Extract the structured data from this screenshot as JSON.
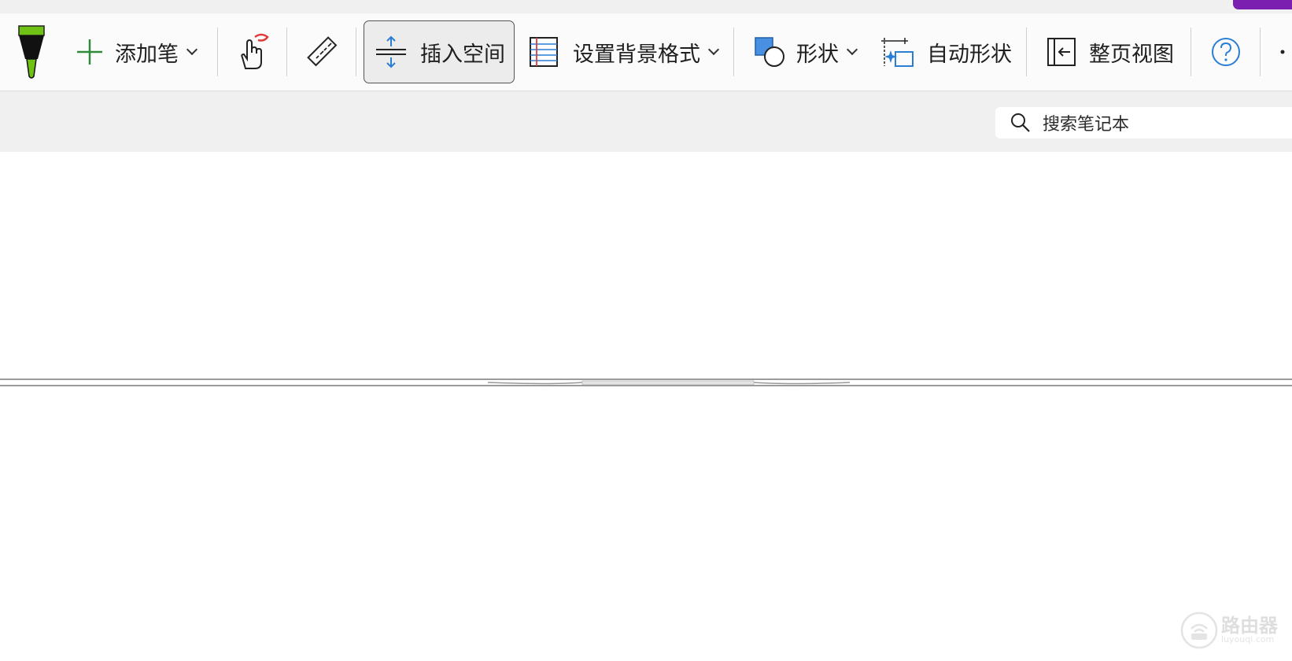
{
  "app": {
    "accent_color": "#7a1fb0"
  },
  "ribbon": {
    "pen_tool": {
      "icon": "pen-icon",
      "color": "#6fc114"
    },
    "add_pen": {
      "label": "添加笔",
      "icon": "plus-icon"
    },
    "touch_draw": {
      "icon": "touch-drawing-icon"
    },
    "ruler": {
      "icon": "ruler-icon"
    },
    "insert_space": {
      "label": "插入空间",
      "icon": "insert-space-icon",
      "active": true
    },
    "format_background": {
      "label": "设置背景格式",
      "icon": "ruled-lines-icon"
    },
    "shapes": {
      "label": "形状",
      "icon": "shapes-icon"
    },
    "auto_shapes": {
      "label": "自动形状",
      "icon": "auto-shapes-icon"
    },
    "full_page_view": {
      "label": "整页视图",
      "icon": "full-page-view-icon"
    },
    "help": {
      "icon": "help-icon"
    },
    "more": {
      "icon": "more-icon"
    }
  },
  "search": {
    "placeholder": "搜索笔记本",
    "icon": "search-icon"
  },
  "watermark": {
    "title": "路由器",
    "subtitle": "luyouqi.com"
  }
}
